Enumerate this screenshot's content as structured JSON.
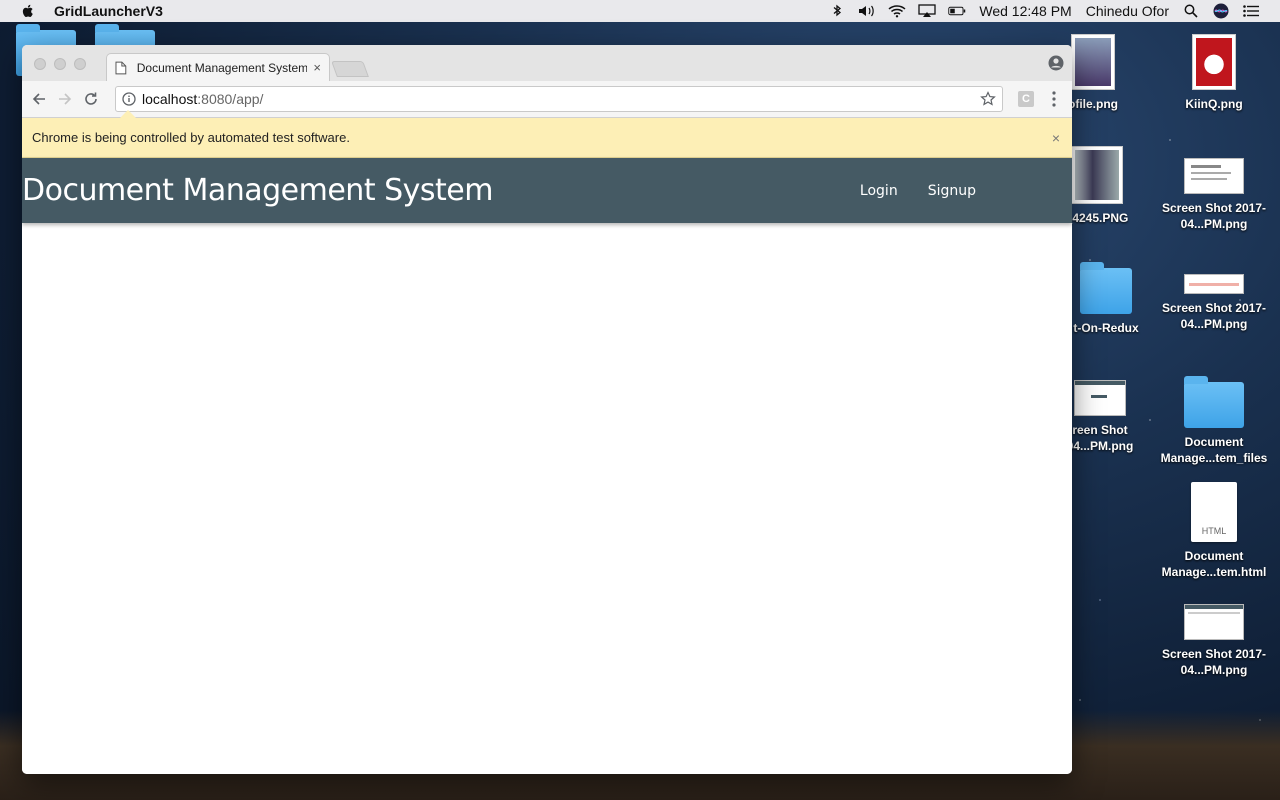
{
  "menubar": {
    "app_name": "GridLauncherV3",
    "clock": "Wed 12:48 PM",
    "user": "Chinedu Ofor"
  },
  "desktop": {
    "icons": [
      {
        "label": "ofile.png",
        "kind": "photo"
      },
      {
        "label": "KiinQ.png",
        "kind": "photo"
      },
      {
        "label": "_4245.PNG",
        "kind": "photo"
      },
      {
        "label": "Screen Shot 2017-04...PM.png",
        "kind": "screenshot"
      },
      {
        "label": "t-On-Redux",
        "kind": "folder"
      },
      {
        "label": "Screen Shot 2017-04...PM.png",
        "kind": "screenshot"
      },
      {
        "label": "reen Shot 04...PM.png",
        "kind": "screenshot"
      },
      {
        "label": "Document Manage...tem_files",
        "kind": "folder"
      },
      {
        "label": "Document Manage...tem.html",
        "kind": "html-file"
      },
      {
        "label": "Screen Shot 2017-04...PM.png",
        "kind": "screenshot"
      }
    ],
    "html_badge": "HTML"
  },
  "browser": {
    "tab_title": "Document Management System",
    "url_host": "localhost",
    "url_path": ":8080/app/",
    "extension_label": "C",
    "infobar_text": "Chrome is being controlled by automated test software.",
    "infobar_close": "×",
    "tab_close": "×"
  },
  "app": {
    "brand": "Document Management System",
    "nav": {
      "login": "Login",
      "signup": "Signup"
    },
    "colors": {
      "navbar": "#455a64",
      "infobar": "#fdefb6"
    }
  }
}
